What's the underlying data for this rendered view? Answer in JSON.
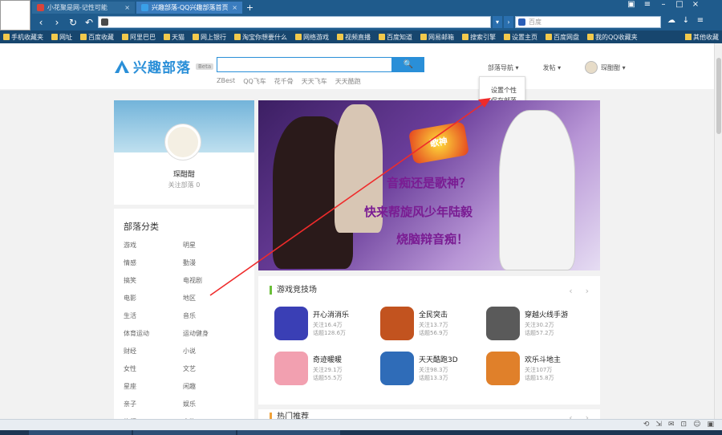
{
  "browser": {
    "tabs": [
      {
        "label": "小花聚是网-记性可能",
        "color": "#d9443a"
      },
      {
        "label": "兴趣部落-QQ兴趣部落首页",
        "color": "#3aa0e8"
      }
    ],
    "newtab_label": "+",
    "search_placeholder": "百度",
    "bookmarks": [
      "手机收藏夹",
      "网址",
      "百度收藏",
      "阿里巴巴",
      "天猫",
      "网上银行",
      "淘宝你想要什么",
      "网络游戏",
      "视频直播",
      "百度知道",
      "网易邮箱",
      "搜索引擎",
      "设置主页",
      "百度网盘",
      "我的QQ收藏夹"
    ],
    "bookmarks_right": "其他收藏"
  },
  "header": {
    "logo": "兴趣部落",
    "beta": "Beta",
    "search_button": "🔍",
    "hot_links": [
      "ZBest",
      "QQ飞车",
      "花千骨",
      "天天飞车",
      "天天酷跑"
    ],
    "tribe_menu": "部落导航 ▾",
    "publish": "发帖 ▾",
    "username": "琛酣酣 ▾"
  },
  "dropdown": {
    "items": [
      "设置个性",
      "保存部落"
    ]
  },
  "profile": {
    "name": "琛酣酣",
    "follow": "关注部落 0"
  },
  "categories": {
    "title": "部落分类",
    "items": [
      "游戏",
      "明星",
      "情感",
      "動漫",
      "搞笑",
      "电视剧",
      "电影",
      "地区",
      "生活",
      "音乐",
      "体育运动",
      "运动健身",
      "财经",
      "小说",
      "女性",
      "文艺",
      "星座",
      "闲趣",
      "亲子",
      "娱乐",
      "旅行",
      "宠物"
    ]
  },
  "banner": {
    "badge": "歌神",
    "slogan1": "音痴还是歌神？",
    "slogan2": "快来帮旋风少年陆毅",
    "slogan3": "烧脑辩音痴！"
  },
  "arena": {
    "title": "游戏竞技场",
    "prev": "‹",
    "next": "›",
    "games": [
      {
        "name": "开心消消乐",
        "follow": "关注16.4万",
        "visit": "话题128.6万",
        "color": "#3a3fb5"
      },
      {
        "name": "全民突击",
        "follow": "关注13.7万",
        "visit": "话题56.9万",
        "color": "#c2531f"
      },
      {
        "name": "穿越火线手游",
        "follow": "关注30.2万",
        "visit": "话题57.2万",
        "color": "#5a5a5a"
      },
      {
        "name": "奇迹暖暖",
        "follow": "关注29.1万",
        "visit": "话题55.5万",
        "color": "#f2a0b0"
      },
      {
        "name": "天天酷跑3D",
        "follow": "关注98.3万",
        "visit": "话题13.3万",
        "color": "#2f6cb8"
      },
      {
        "name": "欢乐斗地主",
        "follow": "关注107万",
        "visit": "话题15.8万",
        "color": "#e0802a"
      }
    ]
  },
  "section2": {
    "title": "热门推荐"
  },
  "status": {
    "icons": [
      "⟲",
      "⇲",
      "✉",
      "⊡",
      "☺",
      "▣"
    ]
  }
}
